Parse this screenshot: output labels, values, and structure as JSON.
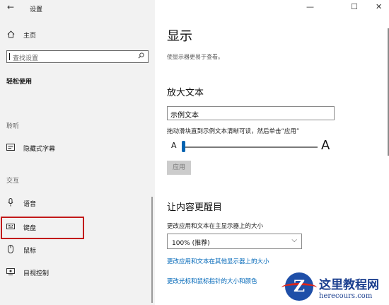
{
  "window": {
    "title": "设置",
    "controls": {
      "minimize": "—",
      "maximize": "☐",
      "close": "✕"
    }
  },
  "sidebar": {
    "home_label": "主页",
    "search_placeholder": "查找设置",
    "category": "轻松使用",
    "sections": [
      {
        "heading": "聆听",
        "items": [
          {
            "label": "隐藏式字幕",
            "icon": "captions-icon"
          }
        ]
      },
      {
        "heading": "交互",
        "items": [
          {
            "label": "语音",
            "icon": "microphone-icon"
          },
          {
            "label": "键盘",
            "icon": "keyboard-icon",
            "highlighted": true
          },
          {
            "label": "鼠标",
            "icon": "mouse-icon"
          },
          {
            "label": "目视控制",
            "icon": "eye-control-icon"
          }
        ]
      }
    ]
  },
  "main": {
    "title": "显示",
    "subtitle": "使显示器更易于查看。",
    "enlarge": {
      "heading": "放大文本",
      "sample_text": "示例文本",
      "hint": "拖动滑块直到示例文本清晰可读，然后单击“应用”",
      "small_a": "A",
      "large_a": "A",
      "slider_level_percent": 0,
      "apply_label": "应用"
    },
    "bigger": {
      "heading": "让内容更醒目",
      "size_label": "更改应用和文本在主显示器上的大小",
      "size_value": "100% (推荐)",
      "link_other_displays": "更改应用和文本在其他显示器上的大小",
      "link_cursor": "更改光标和鼠标指针的大小和颜色"
    }
  },
  "watermark": {
    "logo_letter": "Z",
    "title": "这里教程网",
    "url": "herecours.com"
  },
  "colors": {
    "accent": "#0063b1",
    "link": "#0067b8",
    "highlight_box": "#c21a1a",
    "sidebar_bg": "#f2f2f2"
  }
}
